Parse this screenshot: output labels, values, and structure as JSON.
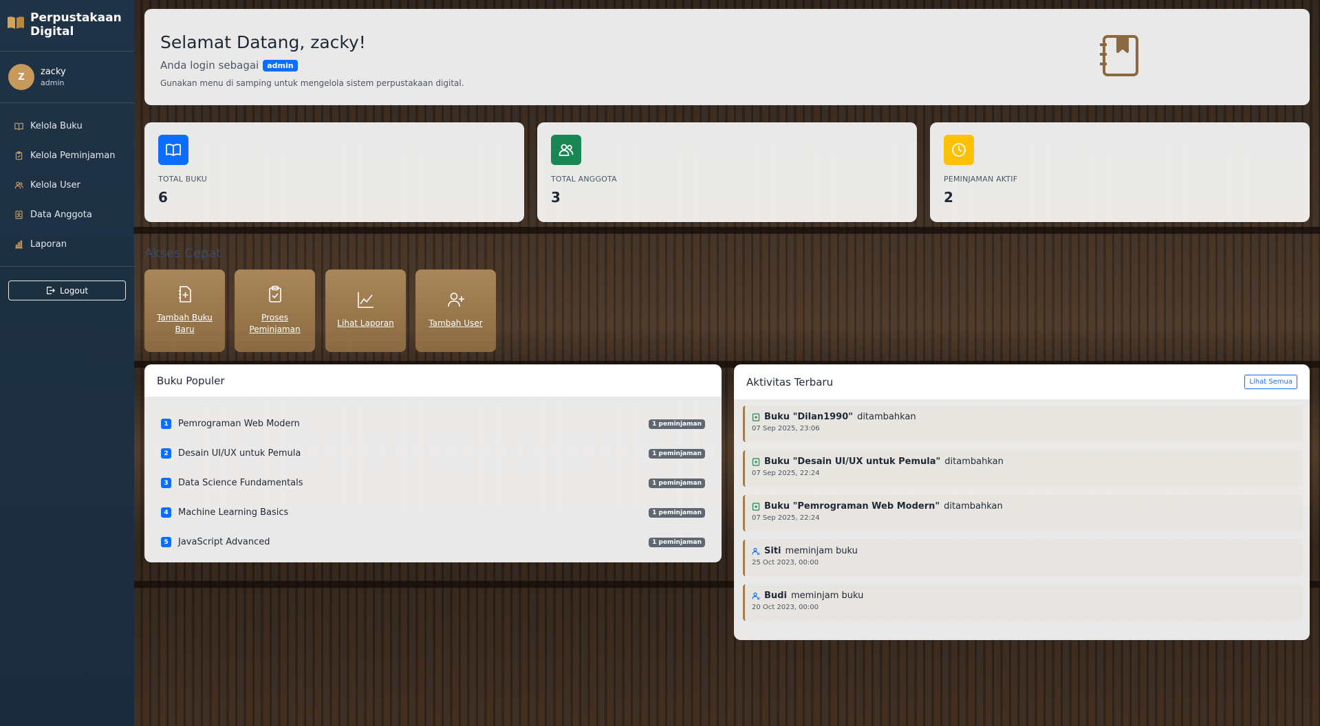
{
  "sidebar": {
    "brand": "Perpustakaan Digital",
    "user": {
      "initial": "Z",
      "name": "zacky",
      "role": "admin"
    },
    "nav": [
      {
        "label": "Kelola Buku",
        "icon": "book-icon"
      },
      {
        "label": "Kelola Peminjaman",
        "icon": "clipboard-icon"
      },
      {
        "label": "Kelola User",
        "icon": "users-icon"
      },
      {
        "label": "Data Anggota",
        "icon": "id-card-icon"
      },
      {
        "label": "Laporan",
        "icon": "bar-chart-icon"
      }
    ],
    "logout": "Logout"
  },
  "welcome": {
    "title": "Selamat Datang, zacky!",
    "subtitle": "Anda login sebagai",
    "role": "admin",
    "hint": "Gunakan menu di samping untuk mengelola sistem perpustakaan digital."
  },
  "stats": [
    {
      "label": "TOTAL BUKU",
      "value": "6",
      "color": "#0d6efd",
      "icon": "book-open-icon"
    },
    {
      "label": "TOTAL ANGGOTA",
      "value": "3",
      "color": "#198754",
      "icon": "people-icon"
    },
    {
      "label": "PEMINJAMAN AKTIF",
      "value": "2",
      "color": "#ffc107",
      "icon": "clock-icon"
    }
  ],
  "quick_access": {
    "title": "Akses Cepat",
    "items": [
      {
        "label": "Tambah Buku Baru",
        "icon": "file-plus-icon"
      },
      {
        "label": "Proses Peminjaman",
        "icon": "clipboard-check-icon"
      },
      {
        "label": "Lihat Laporan",
        "icon": "line-chart-icon"
      },
      {
        "label": "Tambah User",
        "icon": "user-plus-icon"
      }
    ]
  },
  "popular": {
    "title": "Buku Populer",
    "items": [
      {
        "rank": "1",
        "title": "Pemrograman Web Modern",
        "count": "1 peminjaman"
      },
      {
        "rank": "2",
        "title": "Desain UI/UX untuk Pemula",
        "count": "1 peminjaman"
      },
      {
        "rank": "3",
        "title": "Data Science Fundamentals",
        "count": "1 peminjaman"
      },
      {
        "rank": "4",
        "title": "Machine Learning Basics",
        "count": "1 peminjaman"
      },
      {
        "rank": "5",
        "title": "JavaScript Advanced",
        "count": "1 peminjaman"
      }
    ]
  },
  "activity": {
    "title": "Aktivitas Terbaru",
    "see_all": "Lihat Semua",
    "items": [
      {
        "subject": "Buku \"Dilan1990\"",
        "action": "ditambahkan",
        "time": "07 Sep 2025, 23:06",
        "icon": "book-add-icon"
      },
      {
        "subject": "Buku \"Desain UI/UX untuk Pemula\"",
        "action": "ditambahkan",
        "time": "07 Sep 2025, 22:24",
        "icon": "book-add-icon"
      },
      {
        "subject": "Buku \"Pemrograman Web Modern\"",
        "action": "ditambahkan",
        "time": "07 Sep 2025, 22:24",
        "icon": "book-add-icon"
      },
      {
        "subject": "Siti",
        "action": "meminjam buku",
        "time": "25 Oct 2023, 00:00",
        "icon": "user-borrow-icon"
      },
      {
        "subject": "Budi",
        "action": "meminjam buku",
        "time": "20 Oct 2023, 00:00",
        "icon": "user-borrow-icon"
      }
    ]
  },
  "colors": {
    "primary": "#0d6efd",
    "sidebar": "#1f3346",
    "gold": "#a98759"
  }
}
